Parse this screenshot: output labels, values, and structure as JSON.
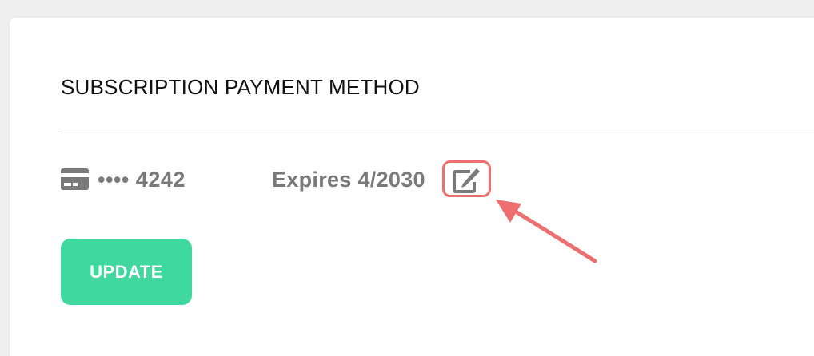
{
  "section": {
    "title": "SUBSCRIPTION PAYMENT METHOD"
  },
  "payment_method": {
    "card_icon": "credit-card-icon",
    "masked_number": "•••• 4242",
    "expiry": "Expires 4/2030",
    "edit_icon": "edit-pencil-icon"
  },
  "actions": {
    "update_label": "UPDATE"
  },
  "colors": {
    "accent_button": "#3fd89f",
    "annotation": "#ee6f6f",
    "muted_text": "#7a7a7a"
  }
}
